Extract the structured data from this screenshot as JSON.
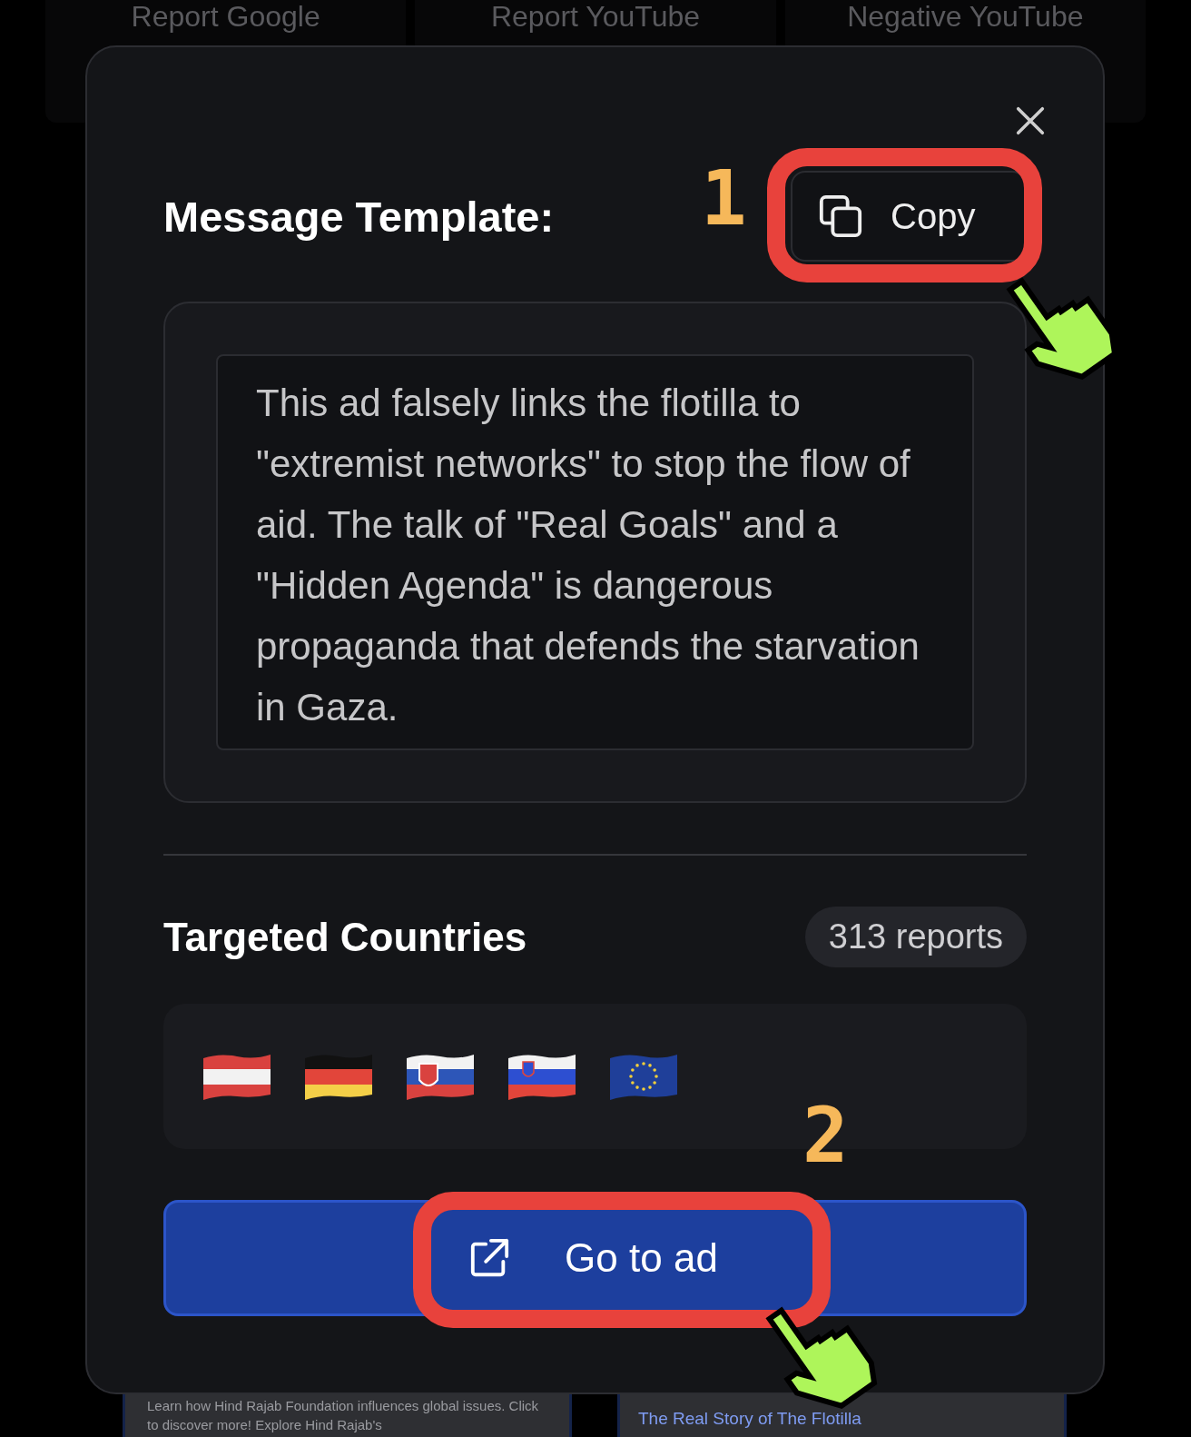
{
  "background": {
    "top_cards": [
      "Report Google",
      "Report YouTube",
      "Negative YouTube"
    ],
    "bottom_left_card": {
      "text": "Learn how Hind Rajab Foundation influences global issues. Click to discover more! Explore Hind Rajab's"
    },
    "bottom_right_card": {
      "link": "The Real Story of The Flotilla"
    }
  },
  "modal": {
    "title": "Message Template:",
    "copy_button": "Copy",
    "template_text": "This ad falsely links the flotilla to \"extremist networks\" to stop the flow of aid. The talk of \"Real Goals\" and a \"Hidden Agenda\" is dangerous propaganda that defends the starvation in Gaza.",
    "section_title": "Targeted Countries",
    "report_count": "313 reports",
    "flags": [
      {
        "kind": "at"
      },
      {
        "kind": "de"
      },
      {
        "kind": "sk"
      },
      {
        "kind": "si"
      },
      {
        "kind": "eu"
      }
    ],
    "action_button": "Go to ad"
  },
  "annotations": [
    {
      "number": "1"
    },
    {
      "number": "2"
    }
  ]
}
